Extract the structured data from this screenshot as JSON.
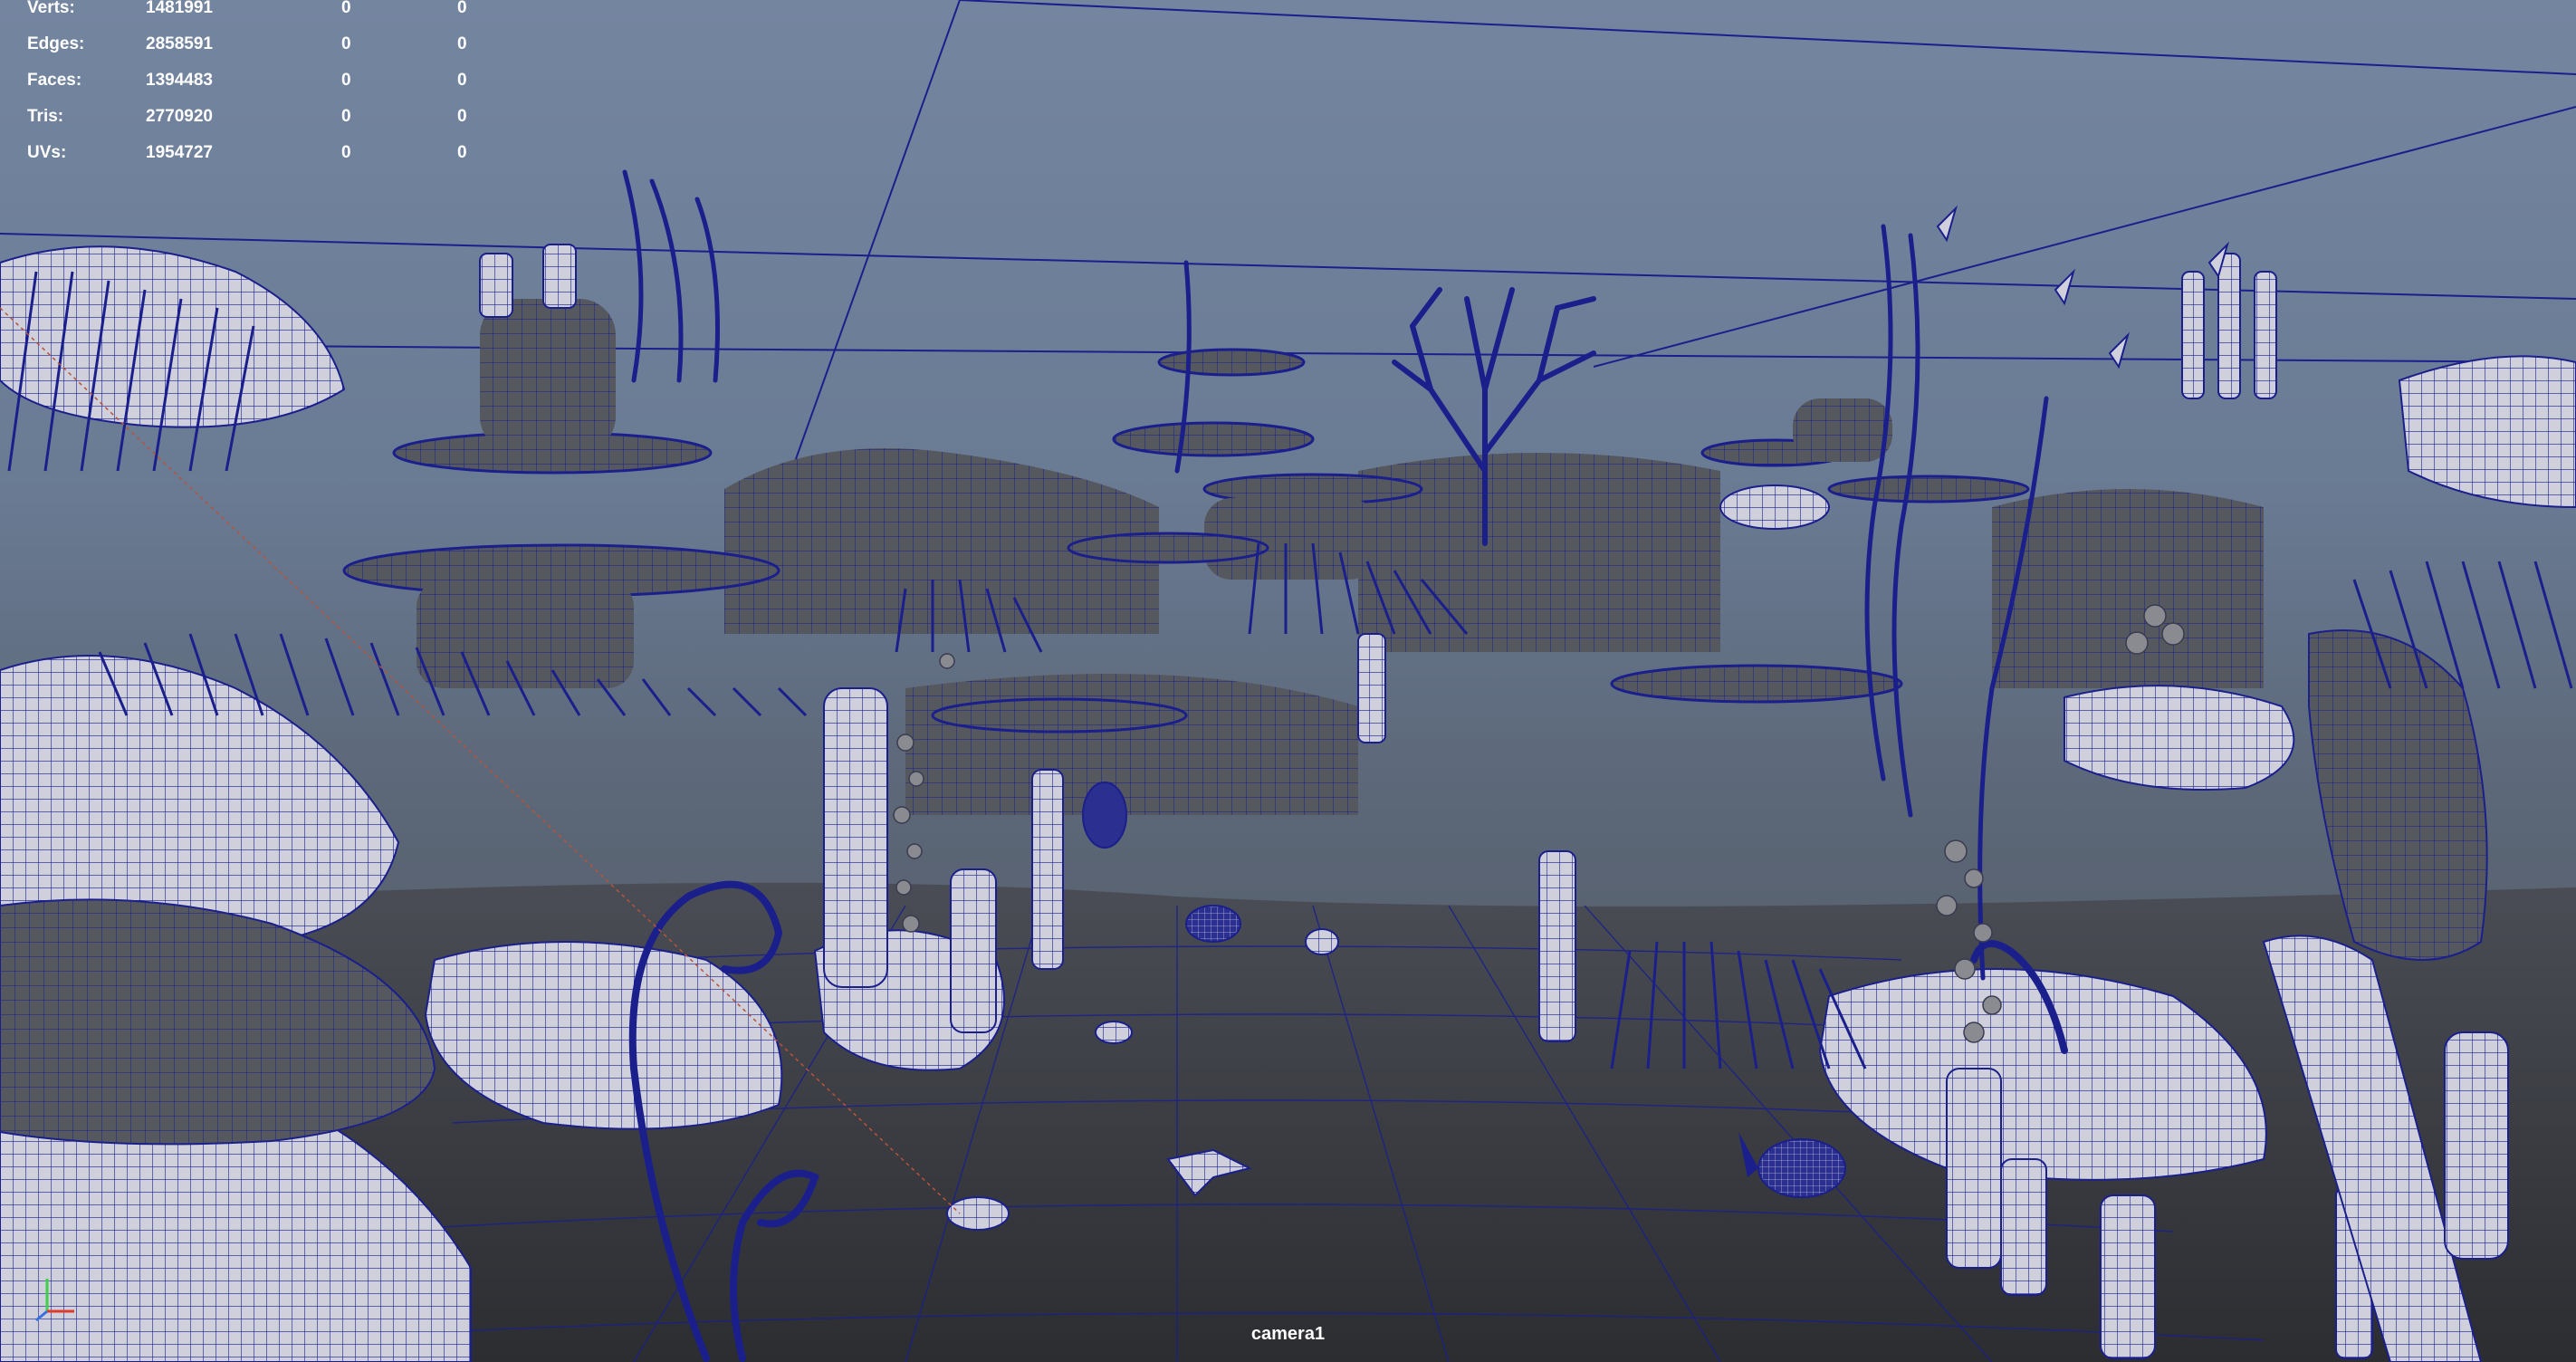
{
  "viewport": {
    "camera_name": "camera1",
    "background_top": "#6e7f99",
    "background_bottom": "#5a6472",
    "wireframe_color": "#1a1f8c"
  },
  "heads_up_display": {
    "poly_count": [
      {
        "label": "Verts:",
        "total": "1481991",
        "selected": "0",
        "selected_components": "0"
      },
      {
        "label": "Edges:",
        "total": "2858591",
        "selected": "0",
        "selected_components": "0"
      },
      {
        "label": "Faces:",
        "total": "1394483",
        "selected": "0",
        "selected_components": "0"
      },
      {
        "label": "Tris:",
        "total": "2770920",
        "selected": "0",
        "selected_components": "0"
      },
      {
        "label": "UVs:",
        "total": "1954727",
        "selected": "0",
        "selected_components": "0"
      }
    ]
  },
  "axis_gizmo": {
    "icon": "view-axis-icon",
    "x_color": "#e03a2a",
    "y_color": "#3fd04a",
    "z_color": "#3a6fe0"
  }
}
